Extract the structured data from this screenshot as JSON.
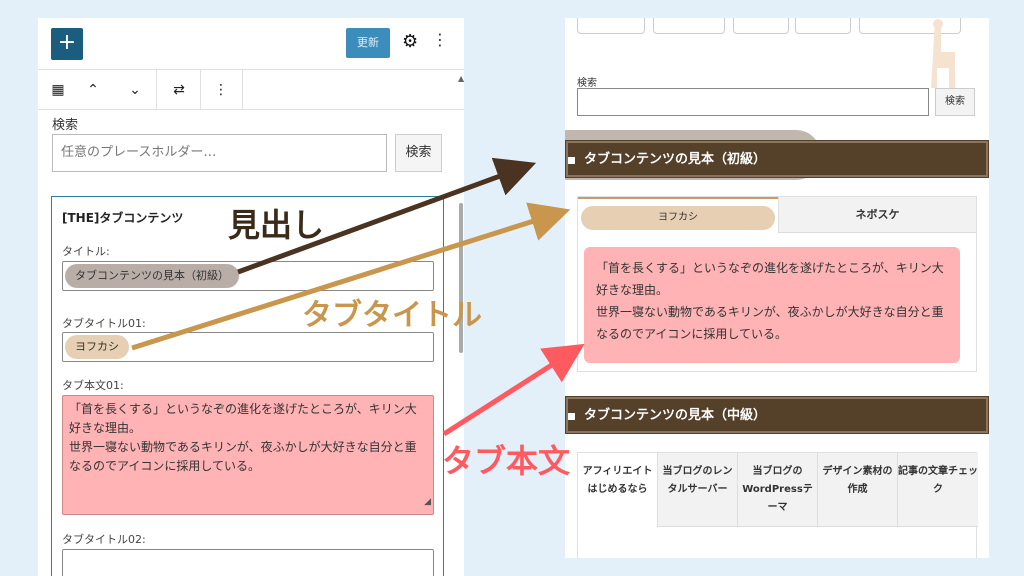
{
  "editor": {
    "add_label": "+",
    "update_label": "更新",
    "gear_icon": "⚙",
    "kebab_icon": "⋮",
    "toolbar": {
      "calendar_icon": "▦",
      "up_icon": "⌃",
      "down_icon": "⌄",
      "transform_icon": "⇄",
      "more_icon": "⋮"
    },
    "search": {
      "label": "検索",
      "placeholder": "任意のプレースホルダー…",
      "button": "検索"
    },
    "tab_block": {
      "title": "[THE]タブコンテンツ",
      "title_field_label": "タイトル:",
      "title_value": "タブコンテンツの見本（初級）",
      "tab_title_01_label": "タブタイトル01:",
      "tab_title_01_value": "ヨフカシ",
      "tab_body_01_label": "タブ本文01:",
      "tab_body_01_line1": "「首を長くする」というなぞの進化を遂げたところが、キリン大好きな理由。",
      "tab_body_01_line2": "世界一寝ない動物であるキリンが、夜ふかしが大好きな自分と重なるのでアイコンに採用している。",
      "tab_title_02_label": "タブタイトル02:"
    }
  },
  "preview": {
    "search": {
      "label": "検索",
      "button": "検索"
    },
    "heading_1": "タブコンテンツの見本（初級）",
    "tab_1": "ヨフカシ",
    "tab_2": "ネボスケ",
    "tab_body_line1": "「首を長くする」というなぞの進化を遂げたところが、キリン大好きな理由。",
    "tab_body_line2": "世界一寝ない動物であるキリンが、夜ふかしが大好きな自分と重なるのでアイコンに採用している。",
    "heading_2": "タブコンテンツの見本（中級）",
    "tabs2": [
      "アフィリエイトはじめるなら",
      "当ブログのレンタルサーバー",
      "当ブログのWordPressテーマ",
      "デザイン素材の作成",
      "記事の文章チェック"
    ]
  },
  "annotations": {
    "heading": "見出し",
    "tab_title": "タブタイトル",
    "tab_body": "タブ本文"
  },
  "colors": {
    "heading_bg": "#55402a",
    "pill_grey": "#b9aea7",
    "pill_beige": "#e6cfb2",
    "body_pink": "#ffb3b5",
    "arrow_dark": "#4a3320",
    "arrow_gold": "#c8964c",
    "arrow_red": "#ff5a5f"
  }
}
